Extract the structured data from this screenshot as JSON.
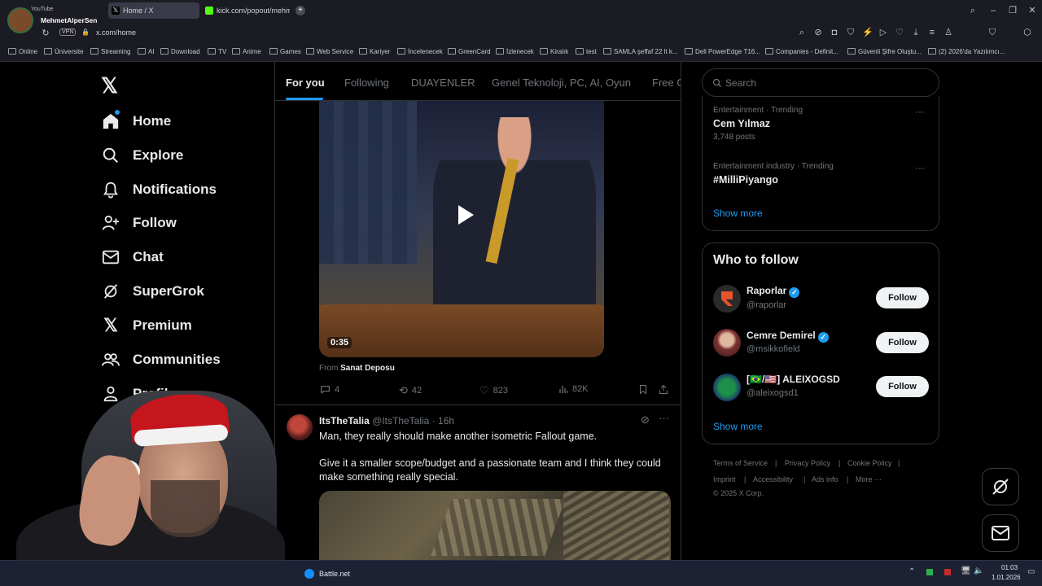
{
  "browser": {
    "profile_name": "MehmetAlperSen",
    "profile_sub": "YouTube",
    "tabs": [
      {
        "label": "Home / X",
        "active": true
      },
      {
        "label": "kick.com/popout/mehmet",
        "active": false
      }
    ],
    "vpn_badge": "VPN",
    "url": "x.com/home",
    "bookmarks": [
      "Online",
      "Üniversite",
      "Streaming",
      "AI",
      "Download",
      "TV",
      "Anime",
      "Games",
      "Web Service",
      "Kariyer",
      "İncelenecek",
      "GreenCard",
      "İzlenecek",
      "Kiralık",
      "test",
      "SAMLA şeffaf 22 lt k...",
      "Dell PowerEdge T16...",
      "Companies - Definit...",
      "Güvenli Şifre Oluştu...",
      "(2) 2026'da Yazılımcı..."
    ]
  },
  "nav": {
    "items": [
      {
        "label": "Home",
        "icon": "home-icon"
      },
      {
        "label": "Explore",
        "icon": "search-icon"
      },
      {
        "label": "Notifications",
        "icon": "bell-icon"
      },
      {
        "label": "Follow",
        "icon": "person-plus-icon"
      },
      {
        "label": "Chat",
        "icon": "mail-icon"
      },
      {
        "label": "SuperGrok",
        "icon": "grok-icon"
      },
      {
        "label": "Premium",
        "icon": "x-logo-icon"
      },
      {
        "label": "Communities",
        "icon": "people-icon"
      },
      {
        "label": "Profil",
        "icon": "person-icon"
      }
    ]
  },
  "feed": {
    "tabs": [
      "For you",
      "Following",
      "DUAYENLER",
      "Genel Teknoloji, PC, AI, Oyun",
      "Free G"
    ],
    "post1": {
      "video_duration": "0:35",
      "from_prefix": "From",
      "from_source": "Sanat Deposu",
      "replies": "4",
      "reposts": "42",
      "likes": "823",
      "views": "82K"
    },
    "post2": {
      "name": "ItsTheTalia",
      "handle": "@ItsTheTalia",
      "time": "· 16h",
      "text1": "Man, they really should make another isometric Fallout game.",
      "text2": "Give it a smaller scope/budget and a passionate team and I think they could make something really special."
    }
  },
  "right": {
    "search_placeholder": "Search",
    "trends": [
      {
        "context": "Entertainment · Trending",
        "title": "Cem Yılmaz",
        "posts": "3,748 posts"
      },
      {
        "context": "Entertainment industry · Trending",
        "title": "#MilliPiyango",
        "posts": ""
      }
    ],
    "show_more": "Show more",
    "who_to_follow": {
      "title": "Who to follow",
      "follow_label": "Follow",
      "users": [
        {
          "name": "Raporlar",
          "handle": "@raporlar"
        },
        {
          "name": "Cemre Demirel",
          "handle": "@msikkofield"
        },
        {
          "name": "[🇧🇷/🇺🇸] ALEIXOGSD",
          "handle": "@aleixogsd1"
        }
      ],
      "show_more": "Show more"
    },
    "footer": [
      "Terms of Service",
      "Privacy Policy",
      "Cookie Policy",
      "Imprint",
      "Accessibility",
      "Ads info",
      "More ···",
      "© 2025 X Corp."
    ]
  },
  "taskbar": {
    "app_label": "Battle.net",
    "time": "01:03",
    "date": "1.01.2026"
  },
  "colors": {
    "accent": "#1d9bf0",
    "background": "#000000",
    "muted": "#71767b"
  }
}
